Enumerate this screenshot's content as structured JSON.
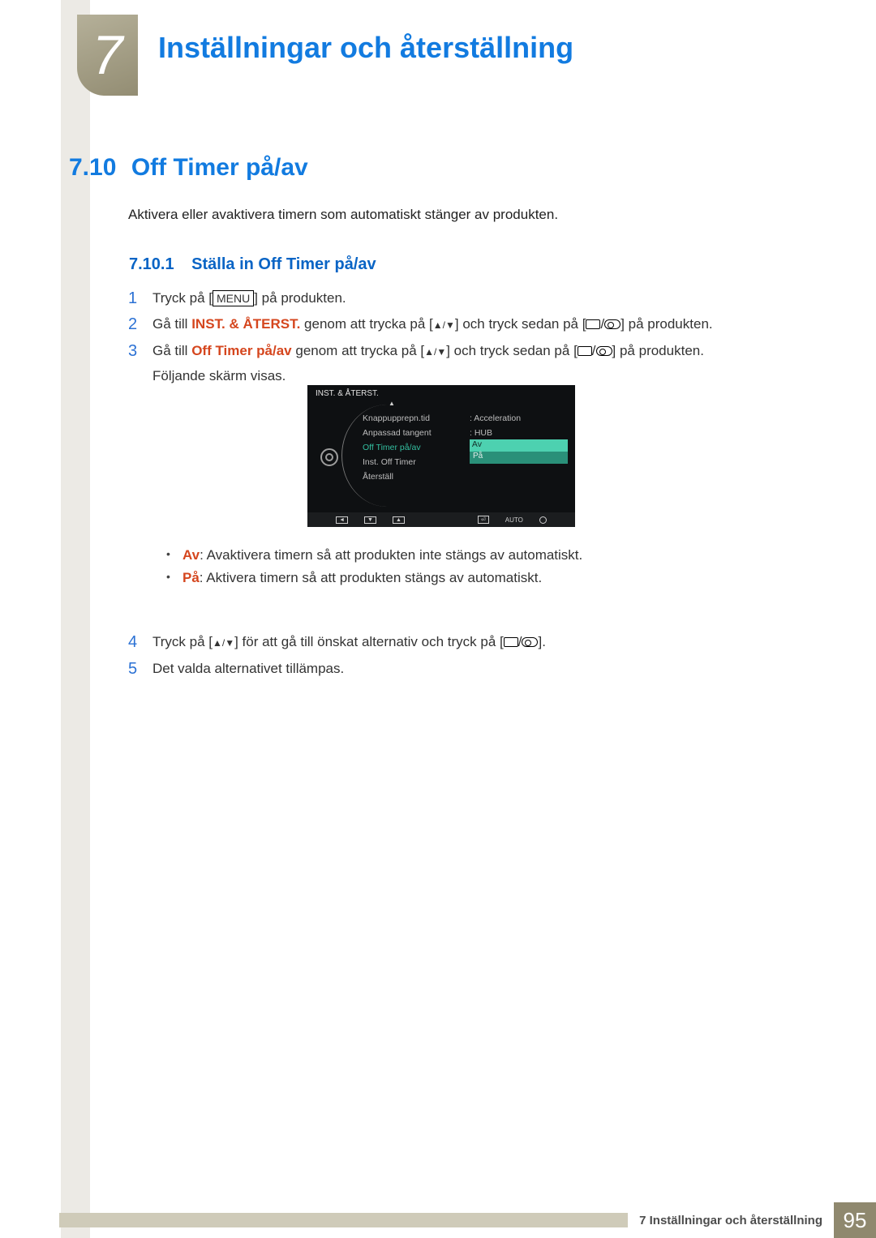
{
  "chapter": {
    "number": "7",
    "title": "Inställningar och återställning"
  },
  "section": {
    "number": "7.10",
    "title": "Off Timer på/av"
  },
  "intro": "Aktivera eller avaktivera timern som automatiskt stänger av produkten.",
  "subsection": {
    "number": "7.10.1",
    "title": "Ställa in Off Timer på/av"
  },
  "steps": {
    "s1": {
      "n": "1",
      "pre": "Tryck på [",
      "menu": "MENU",
      "post": "] på produkten."
    },
    "s2": {
      "n": "2",
      "a": "Gå till ",
      "b": "INST. & ÅTERST.",
      "c": " genom att trycka på [",
      "d": "] och tryck sedan på [",
      "e": "] på produkten."
    },
    "s3": {
      "n": "3",
      "a": "Gå till ",
      "b": "Off Timer på/av",
      "c": " genom att trycka på [",
      "d": "] och tryck sedan på [",
      "e": "] på produkten.",
      "f": "Följande skärm visas."
    },
    "s4": {
      "n": "4",
      "a": "Tryck på [",
      "b": "] för att gå till önskat alternativ och tryck på [",
      "c": "]."
    },
    "s5": {
      "n": "5",
      "a": "Det valda alternativet tillämpas."
    }
  },
  "osd": {
    "title": "INST. & ÅTERST.",
    "rows": {
      "r1": {
        "label": "Knappupprepn.tid",
        "val": "Acceleration"
      },
      "r2": {
        "label": "Anpassad tangent",
        "val": "HUB"
      },
      "r3": {
        "label": "Off Timer på/av",
        "val": "Av"
      },
      "r4": {
        "label": "Inst. Off Timer",
        "val": "På"
      },
      "r5": {
        "label": "Återställ",
        "val": ""
      }
    },
    "bottom": {
      "auto": "AUTO"
    }
  },
  "bullets": {
    "b1": {
      "label": "Av",
      "text": ": Avaktivera timern så att produkten inte stängs av automatiskt."
    },
    "b2": {
      "label": "På",
      "text": ": Aktivera timern så att produkten stängs av automatiskt."
    }
  },
  "footer": {
    "caption": "7 Inställningar och återställning",
    "page": "95"
  }
}
